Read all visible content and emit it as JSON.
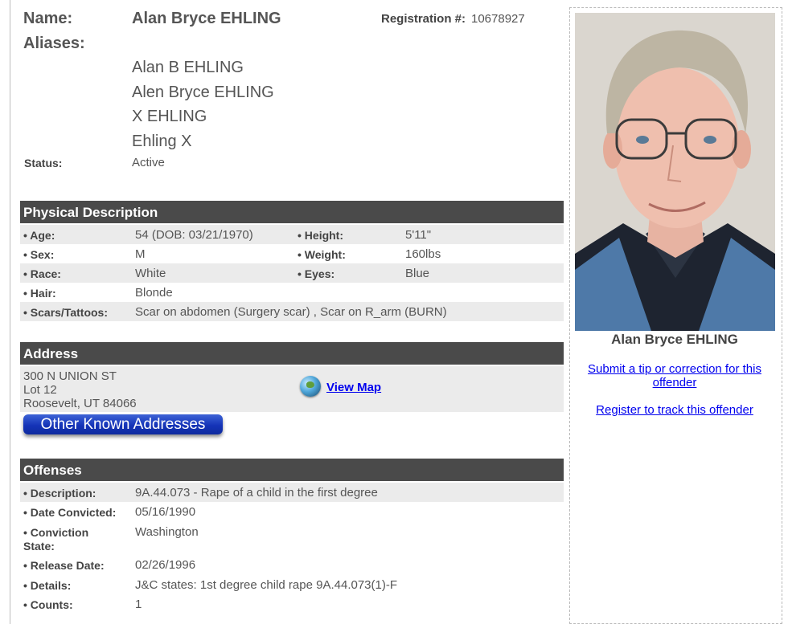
{
  "offender": {
    "name_label": "Name:",
    "name": "Alan Bryce EHLING",
    "registration_label": "Registration #:",
    "registration_number": "10678927",
    "aliases_label": "Aliases:",
    "aliases": [
      "Alan B EHLING",
      "Alen Bryce EHLING",
      "X EHLING",
      "Ehling X"
    ],
    "status_label": "Status:",
    "status": "Active"
  },
  "physical": {
    "title": "Physical Description",
    "age_label": "• Age:",
    "age": "54  (DOB: 03/21/1970)",
    "sex_label": "• Sex:",
    "sex": "M",
    "race_label": "• Race:",
    "race": "White",
    "hair_label": "• Hair:",
    "hair": "Blonde",
    "scars_label": "• Scars/Tattoos:",
    "scars": "Scar on abdomen (Surgery scar) , Scar on R_arm (BURN)",
    "height_label": "• Height:",
    "height": "5'11\"",
    "weight_label": "• Weight:",
    "weight": "160lbs",
    "eyes_label": "• Eyes:",
    "eyes": "Blue"
  },
  "address": {
    "title": "Address",
    "line1": "300 N UNION ST",
    "line2": "Lot 12",
    "line3": "Roosevelt, UT 84066",
    "view_map": "View Map",
    "other_addresses": "Other Known Addresses"
  },
  "offenses": {
    "title": "Offenses",
    "description_label": "• Description:",
    "description": "9A.44.073 - Rape of a child in the first degree",
    "date_convicted_label": "• Date Convicted:",
    "date_convicted": "05/16/1990",
    "conviction_state_label_1": "• Conviction",
    "conviction_state_label_2": "State:",
    "conviction_state": "Washington",
    "release_date_label": "• Release Date:",
    "release_date": "02/26/1996",
    "details_label": "• Details:",
    "details": "J&C states: 1st degree child rape 9A.44.073(1)-F",
    "counts_label": "• Counts:",
    "counts": "1"
  },
  "sidebar": {
    "photo_caption": "Alan Bryce EHLING",
    "tip_link_line1": "Submit a tip or correction for this",
    "tip_link_line2": "offender",
    "register_link": "Register to track this offender"
  },
  "colors": {
    "section_header_bg": "#4a4a4a",
    "row_shade": "#ebebeb",
    "link": "#0000ee",
    "button_blue": "#1534b8"
  }
}
